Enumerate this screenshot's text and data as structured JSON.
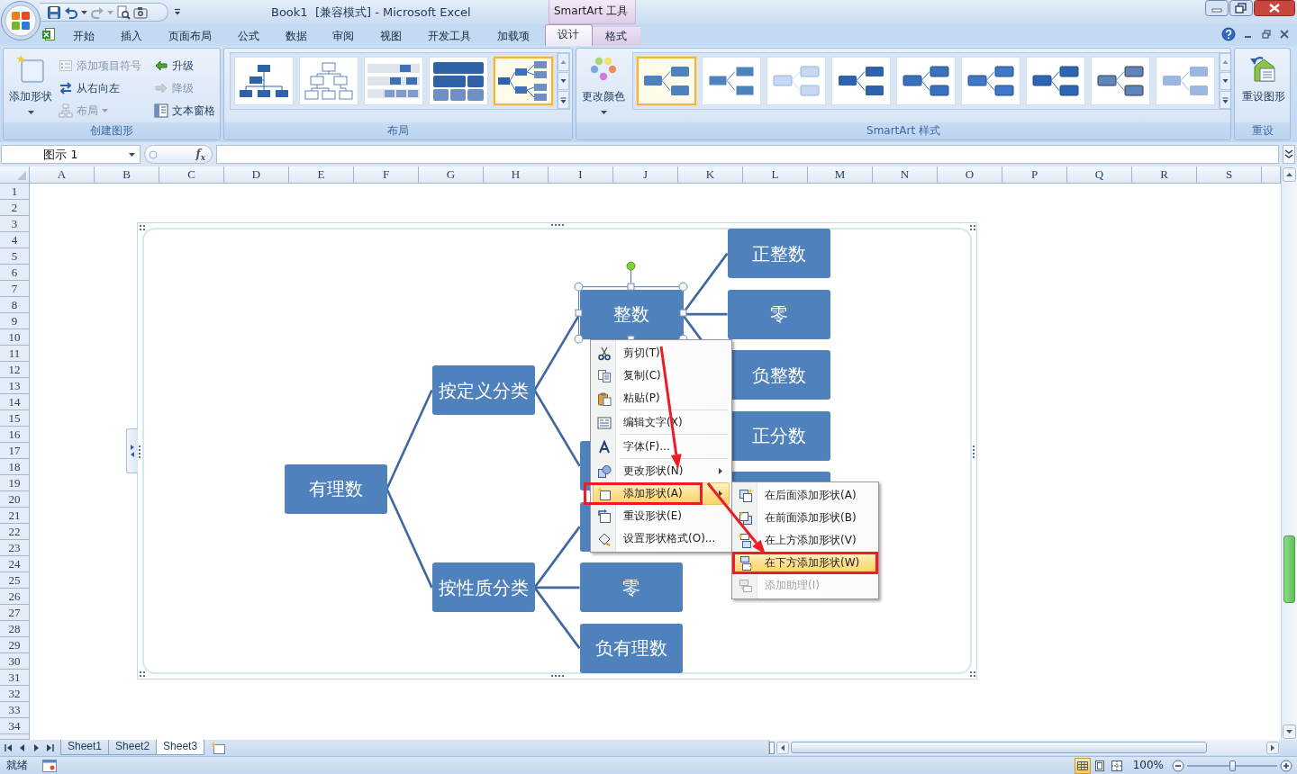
{
  "title_bar": {
    "quick_access": [
      {
        "disabled": false,
        "dropdown": false
      },
      {
        "disabled": false,
        "dropdown": true
      },
      {
        "disabled": true,
        "dropdown": true
      },
      {
        "disabled": false,
        "dropdown": false
      },
      {
        "disabled": false,
        "dropdown": false
      }
    ],
    "title": "Book1  [兼容模式] - Microsoft Excel",
    "context_label": "SmartArt 工具"
  },
  "ribbon": {
    "tabs": [
      {
        "label": "开始",
        "selected": false,
        "contextual": false
      },
      {
        "label": "插入",
        "selected": false,
        "contextual": false
      },
      {
        "label": "页面布局",
        "selected": false,
        "contextual": false
      },
      {
        "label": "公式",
        "selected": false,
        "contextual": false
      },
      {
        "label": "数据",
        "selected": false,
        "contextual": false
      },
      {
        "label": "审阅",
        "selected": false,
        "contextual": false
      },
      {
        "label": "视图",
        "selected": false,
        "contextual": false
      },
      {
        "label": "开发工具",
        "selected": false,
        "contextual": false
      },
      {
        "label": "加载项",
        "selected": false,
        "contextual": false
      },
      {
        "label": "设计",
        "selected": true,
        "contextual": true
      },
      {
        "label": "格式",
        "selected": false,
        "contextual": true
      }
    ],
    "groups": [
      {
        "kind": "create",
        "title": "创建图形",
        "large": {
          "label": "添加形状",
          "dropdown": true
        },
        "buttons": [
          {
            "label": "添加项目符号",
            "disabled": true,
            "dropdown": false
          },
          {
            "label": "从右向左",
            "disabled": false,
            "dropdown": false
          },
          {
            "label": "布局",
            "disabled": true,
            "dropdown": true
          },
          {
            "label": "升级",
            "disabled": false,
            "dropdown": false
          },
          {
            "label": "降级",
            "disabled": true,
            "dropdown": false
          },
          {
            "label": "文本窗格",
            "disabled": false,
            "dropdown": false
          }
        ]
      },
      {
        "kind": "layouts",
        "title": "布局",
        "items": [
          {
            "selected": false
          },
          {
            "selected": false
          },
          {
            "selected": false
          },
          {
            "selected": false
          },
          {
            "selected": true
          }
        ]
      },
      {
        "kind": "styles",
        "title": "SmartArt 样式",
        "large": {
          "label": "更改颜色",
          "dropdown": true
        },
        "items": [
          {
            "selected": true
          },
          {
            "selected": false
          },
          {
            "selected": false
          },
          {
            "selected": false
          },
          {
            "selected": false
          },
          {
            "selected": false
          },
          {
            "selected": false
          },
          {
            "selected": false
          },
          {
            "selected": false
          }
        ]
      },
      {
        "kind": "reset",
        "title": "重设",
        "large": {
          "label": "重设图形",
          "dropdown": false
        }
      }
    ]
  },
  "formula_bar": {
    "name_box": "图示 1",
    "function_label": "f$_{x}$"
  },
  "sheet": {
    "columns": [
      "A",
      "B",
      "C",
      "D",
      "E",
      "F",
      "G",
      "H",
      "I",
      "J",
      "K",
      "L",
      "M",
      "N",
      "O",
      "P",
      "Q",
      "R",
      "S"
    ],
    "rows": [
      "1",
      "2",
      "3",
      "4",
      "5",
      "6",
      "7",
      "8",
      "9",
      "10",
      "11",
      "12",
      "13",
      "14",
      "15",
      "16",
      "17",
      "18",
      "19",
      "20",
      "21",
      "22",
      "23",
      "24",
      "25",
      "26",
      "27",
      "28",
      "29",
      "30",
      "31",
      "32",
      "33",
      "34"
    ]
  },
  "smartart": {
    "nodes": [
      {
        "text": "有理数",
        "selected": false,
        "children": [
          {
            "text": "按定义分类",
            "selected": false,
            "children": [
              {
                "text": "整数",
                "selected": true,
                "children": [
                  {
                    "text": "正整数",
                    "selected": false
                  },
                  {
                    "text": "零",
                    "selected": false
                  },
                  {
                    "text": "负整数",
                    "selected": false
                  }
                ]
              },
              {
                "selected": false,
                "children": [
                  {
                    "text": "正分数",
                    "selected": false
                  },
                  {
                    "selected": false
                  }
                ]
              }
            ]
          },
          {
            "text": "按性质分类",
            "selected": false,
            "children": [
              {
                "selected": false
              },
              {
                "text": "零",
                "selected": false
              },
              {
                "text": "负有理数",
                "selected": false
              }
            ]
          }
        ]
      }
    ]
  },
  "context_menu": {
    "items": [
      {
        "kind": "item",
        "label": "剪切(T)",
        "has_submenu": false,
        "highlighted": false,
        "annotated": false
      },
      {
        "kind": "item",
        "label": "复制(C)",
        "has_submenu": false,
        "highlighted": false,
        "annotated": false
      },
      {
        "kind": "item",
        "label": "粘贴(P)",
        "has_submenu": false,
        "highlighted": false,
        "annotated": false
      },
      {
        "kind": "separator"
      },
      {
        "kind": "item",
        "label": "编辑文字(X)",
        "has_submenu": false,
        "highlighted": false,
        "annotated": false
      },
      {
        "kind": "separator"
      },
      {
        "kind": "item",
        "label": "字体(F)...",
        "has_submenu": false,
        "highlighted": false,
        "annotated": false
      },
      {
        "kind": "separator"
      },
      {
        "kind": "item",
        "label": "更改形状(N)",
        "has_submenu": true,
        "highlighted": false,
        "annotated": false
      },
      {
        "kind": "item",
        "label": "添加形状(A)",
        "has_submenu": true,
        "highlighted": true,
        "annotated": true
      },
      {
        "kind": "item",
        "label": "重设形状(E)",
        "has_submenu": false,
        "highlighted": false,
        "annotated": false
      },
      {
        "kind": "item",
        "label": "设置形状格式(O)...",
        "has_submenu": false,
        "highlighted": false,
        "annotated": false
      }
    ]
  },
  "submenu": {
    "items": [
      {
        "label": "在后面添加形状(A)",
        "disabled": false,
        "highlighted": false,
        "annotated": false
      },
      {
        "label": "在前面添加形状(B)",
        "disabled": false,
        "highlighted": false,
        "annotated": false
      },
      {
        "label": "在上方添加形状(V)",
        "disabled": false,
        "highlighted": false,
        "annotated": false
      },
      {
        "label": "在下方添加形状(W)",
        "disabled": false,
        "highlighted": true,
        "annotated": true
      },
      {
        "label": "添加助理(I)",
        "disabled": true,
        "highlighted": false,
        "annotated": false
      }
    ]
  },
  "sheet_tabs": [
    {
      "label": "Sheet1",
      "selected": false
    },
    {
      "label": "Sheet2",
      "selected": false
    },
    {
      "label": "Sheet3",
      "selected": true
    }
  ],
  "status_bar": {
    "status": "就绪",
    "views": [
      {
        "selected": true
      },
      {
        "selected": false
      },
      {
        "selected": false
      }
    ],
    "zoom": "100%",
    "zoom_slider": {
      "level": 0.5
    }
  }
}
